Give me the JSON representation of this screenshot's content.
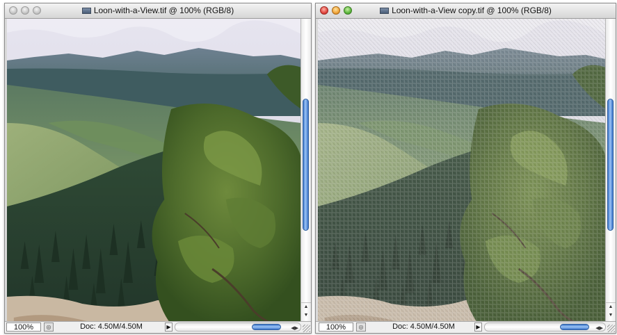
{
  "windows": [
    {
      "title": "Loon-with-a-View.tif @ 100% (RGB/8)",
      "state": "inactive",
      "zoom": "100%",
      "doc_info": "Doc: 4.50M/4.50M",
      "image_style": "original",
      "image_description": "mountain valley landscape with a green pine tree"
    },
    {
      "title": "Loon-with-a-View copy.tif @ 100% (RGB/8)",
      "state": "active",
      "zoom": "100%",
      "doc_info": "Doc: 4.50M/4.50M",
      "image_style": "canvas-texture filtered",
      "image_description": "same landscape with canvas texture filter applied"
    }
  ],
  "icons": {
    "document": "document-icon",
    "status_menu": "play-triangle-icon",
    "scroll_up": "arrow-up-icon",
    "scroll_down": "arrow-down-icon",
    "scroll_left": "arrow-left-icon",
    "scroll_right": "arrow-right-icon"
  },
  "colors": {
    "scroll_thumb": "#3a73c9",
    "close": "#e0443e",
    "minimize": "#f0a43a",
    "zoom": "#5bb63c"
  }
}
